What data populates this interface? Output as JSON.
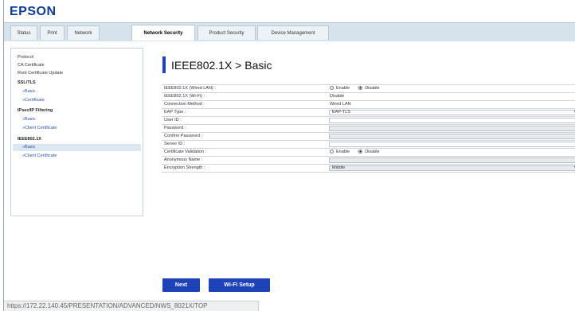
{
  "header": {
    "logo": "EPSON"
  },
  "tabs": [
    {
      "label": "Status"
    },
    {
      "label": "Print"
    },
    {
      "label": "Network"
    },
    {
      "label": "Network Security"
    },
    {
      "label": "Product Security"
    },
    {
      "label": "Device Management"
    }
  ],
  "active_tab": "Network Security",
  "sidebar": {
    "items": [
      {
        "label": "Protocol"
      },
      {
        "label": "CA Certificate"
      },
      {
        "label": "Root Certificate Update"
      },
      {
        "label": "SSL/TLS"
      },
      {
        "label": "»Basic"
      },
      {
        "label": "»Certificate"
      },
      {
        "label": "IPsec/IP Filtering"
      },
      {
        "label": "»Basic"
      },
      {
        "label": "»Client Certificate"
      },
      {
        "label": "IEEE802.1X"
      },
      {
        "label": "»Basic"
      },
      {
        "label": "»Client Certificate"
      }
    ]
  },
  "page": {
    "title": "IEEE802.1X > Basic"
  },
  "form": {
    "rows": [
      {
        "label": "IEEE802.1X (Wired LAN) :",
        "enable": "Enable",
        "disable": "Disable"
      },
      {
        "label": "IEEE802.1X (Wi-Fi) :",
        "value": "Disable"
      },
      {
        "label": "Connection Method :",
        "value": "Wired LAN"
      },
      {
        "label": "EAP Type :",
        "value": "EAP-TLS"
      },
      {
        "label": "User ID :",
        "value": ""
      },
      {
        "label": "Password :",
        "value": ""
      },
      {
        "label": "Confirm Password :",
        "value": ""
      },
      {
        "label": "Server ID :",
        "value": ""
      },
      {
        "label": "Certificate Validation :",
        "enable": "Enable",
        "disable": "Disable"
      },
      {
        "label": "Anonymous Name :",
        "value": ""
      },
      {
        "label": "Encryption Strength :",
        "value": "Middle"
      }
    ]
  },
  "buttons": {
    "next": "Next",
    "wifi_setup": "Wi-Fi Setup"
  },
  "status_bar": {
    "url": "https://172.22.140.45/PRESENTATION/ADVANCED/NWS_8021X/TOP"
  },
  "colors": {
    "accent": "#1e43b8",
    "tabbar": "#d7e3ec",
    "logo": "#103c96"
  }
}
